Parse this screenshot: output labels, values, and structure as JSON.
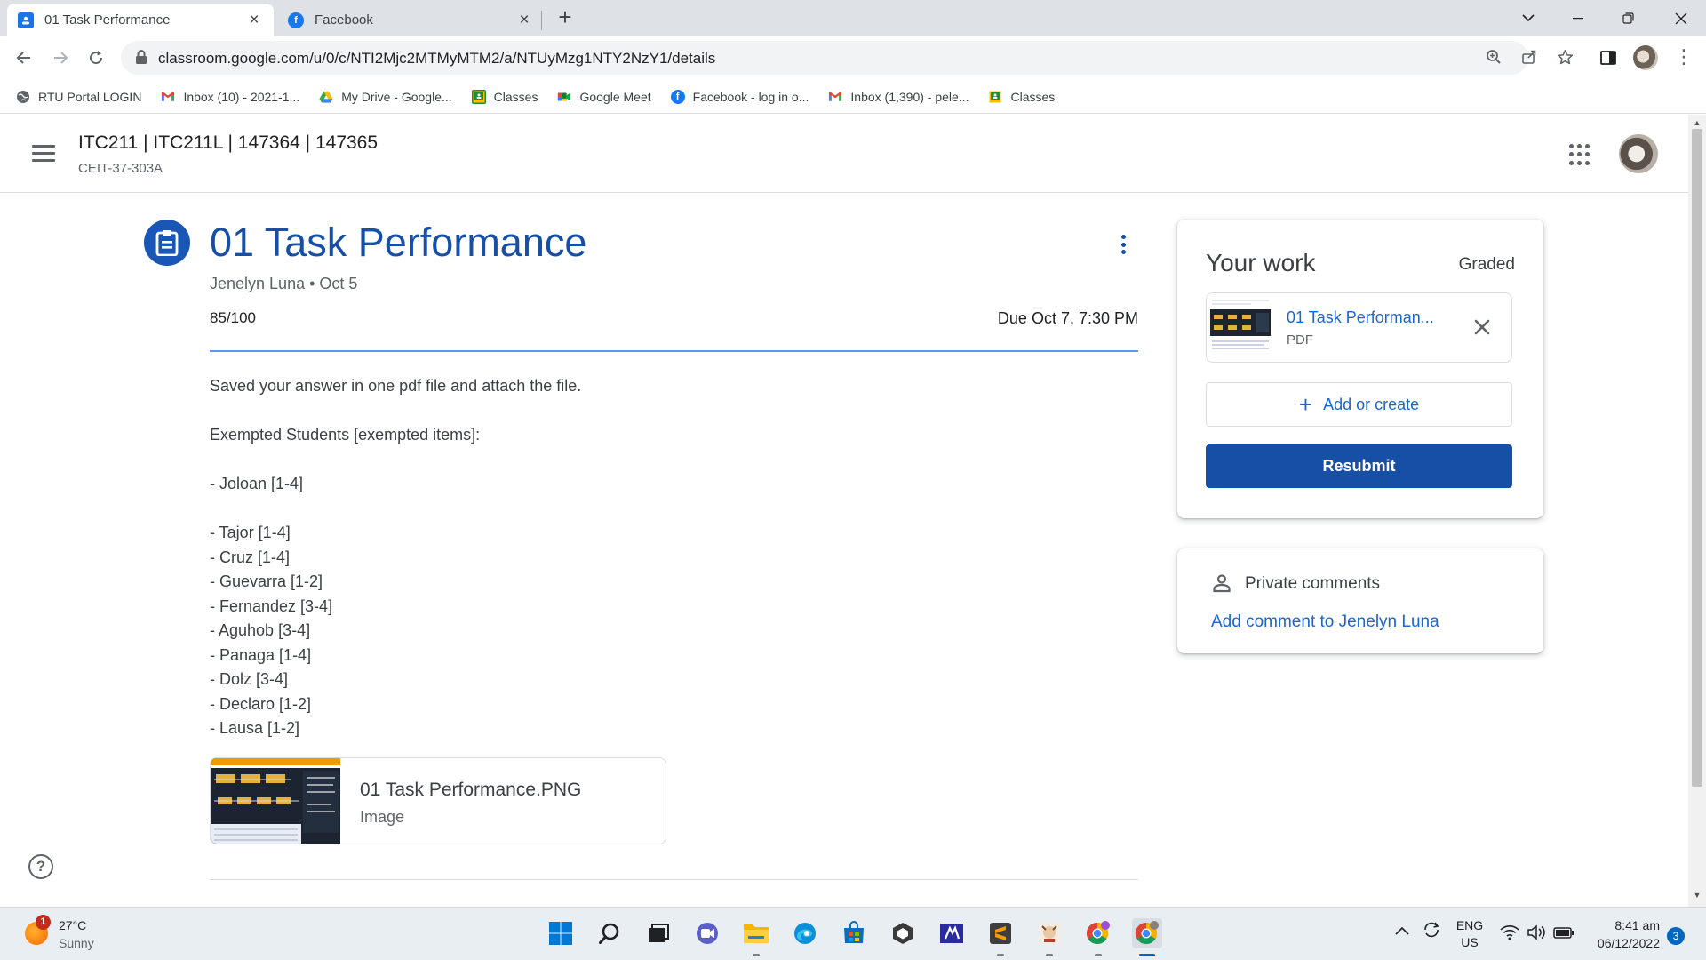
{
  "browser": {
    "tabs": [
      {
        "title": "01 Task Performance",
        "active": true
      },
      {
        "title": "Facebook",
        "active": false
      }
    ],
    "url": "classroom.google.com/u/0/c/NTI2Mjc2MTMyMTM2/a/NTUyMzg1NTY2NzY1/details",
    "bookmarks": [
      {
        "label": "RTU Portal LOGIN",
        "icon": "globe-icon"
      },
      {
        "label": "Inbox (10) - 2021-1...",
        "icon": "gmail-icon"
      },
      {
        "label": "My Drive - Google...",
        "icon": "drive-icon"
      },
      {
        "label": "Classes",
        "icon": "classroom-icon"
      },
      {
        "label": "Google Meet",
        "icon": "meet-icon"
      },
      {
        "label": "Facebook - log in o...",
        "icon": "facebook-icon"
      },
      {
        "label": "Inbox (1,390) - pele...",
        "icon": "gmail-icon"
      },
      {
        "label": "Classes",
        "icon": "classroom-icon"
      }
    ]
  },
  "header": {
    "class_title": "ITC211 | ITC211L | 147364 | 147365",
    "class_section": "CEIT-37-303A"
  },
  "assignment": {
    "title": "01 Task Performance",
    "meta": "Jenelyn Luna • Oct 5",
    "points": "85/100",
    "due": "Due Oct 7, 7:30 PM",
    "instructions": "Saved your answer in one pdf file and attach the file.\n\nExempted Students [exempted items]:\n\n- Joloan [1-4]\n\n- Tajor [1-4]\n- Cruz [1-4]\n- Guevarra [1-2]\n- Fernandez [3-4]\n- Aguhob [3-4]\n- Panaga [1-4]\n- Dolz [3-4]\n- Declaro [1-2]\n- Lausa [1-2]",
    "attachment": {
      "name": "01 Task Performance.PNG",
      "type": "Image"
    }
  },
  "your_work": {
    "title": "Your work",
    "status": "Graded",
    "file": {
      "name": "01 Task Performan...",
      "type": "PDF"
    },
    "add_label": "Add or create",
    "resubmit_label": "Resubmit"
  },
  "private_comments": {
    "title": "Private comments",
    "add_label": "Add comment to Jenelyn Luna"
  },
  "taskbar": {
    "weather_temp": "27°C",
    "weather_desc": "Sunny",
    "weather_badge": "1",
    "lang_top": "ENG",
    "lang_bottom": "US",
    "time": "8:41 am",
    "date": "06/12/2022",
    "notifications": "3"
  },
  "colors": {
    "classroom_blue": "#174ea6",
    "link_blue": "#1967d2",
    "accent_line": "#4285f4"
  }
}
